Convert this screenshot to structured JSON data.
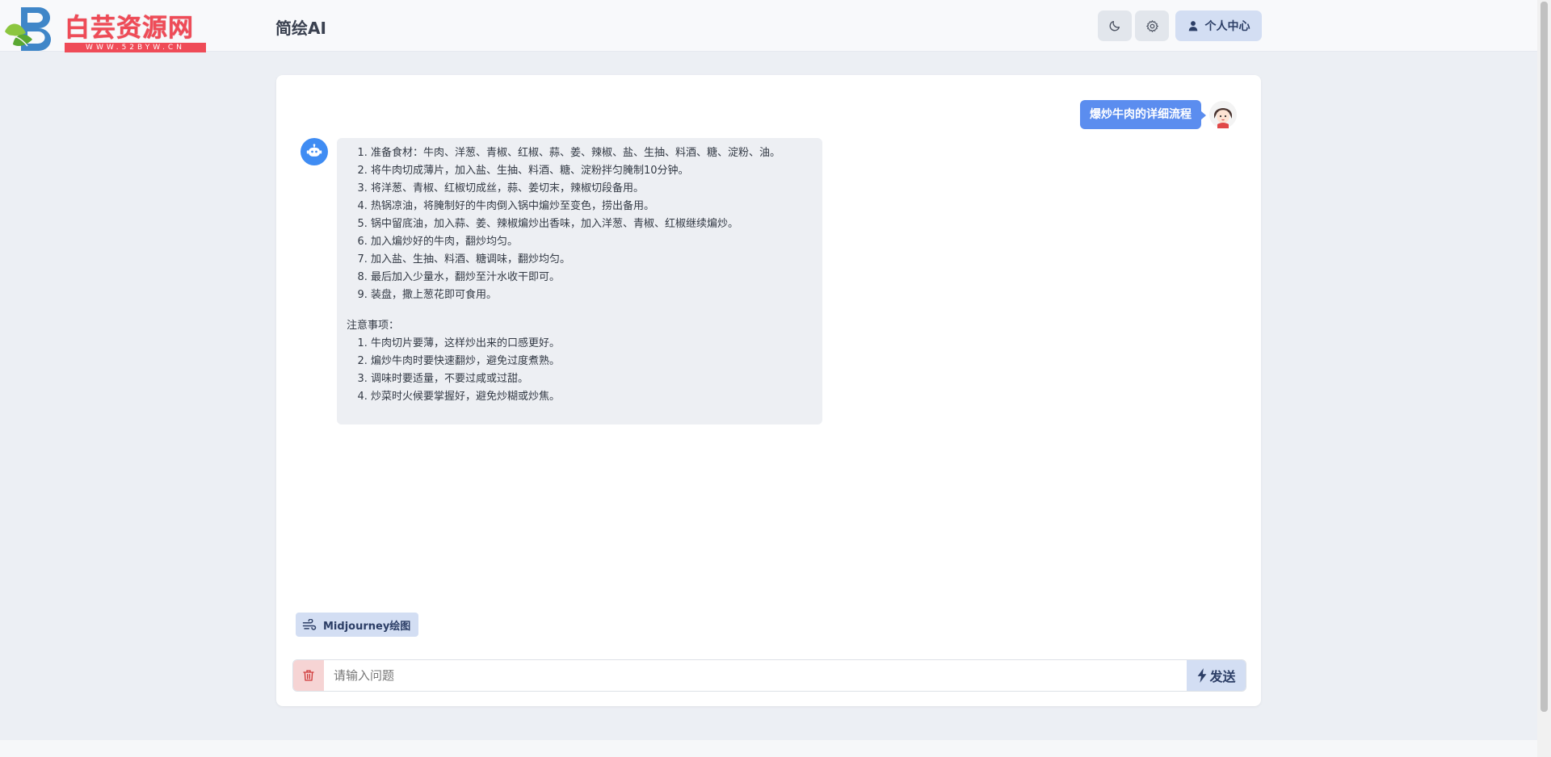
{
  "logo": {
    "text": "白芸资源网",
    "url": "WWW.52BYW.CN"
  },
  "header": {
    "title": "简绘AI",
    "user_center_label": "个人中心"
  },
  "conversation": {
    "user_message": "爆炒牛肉的详细流程",
    "steps": [
      "准备食材：牛肉、洋葱、青椒、红椒、蒜、姜、辣椒、盐、生抽、料酒、糖、淀粉、油。",
      "将牛肉切成薄片，加入盐、生抽、料酒、糖、淀粉拌匀腌制10分钟。",
      "将洋葱、青椒、红椒切成丝，蒜、姜切末，辣椒切段备用。",
      "热锅凉油，将腌制好的牛肉倒入锅中煸炒至变色，捞出备用。",
      "锅中留底油，加入蒜、姜、辣椒煸炒出香味，加入洋葱、青椒、红椒继续煸炒。",
      "加入煸炒好的牛肉，翻炒均匀。",
      "加入盐、生抽、料酒、糖调味，翻炒均匀。",
      "最后加入少量水，翻炒至汁水收干即可。",
      "装盘，撒上葱花即可食用。"
    ],
    "notes_title": "注意事项：",
    "notes": [
      "牛肉切片要薄，这样炒出来的口感更好。",
      "煸炒牛肉时要快速翻炒，避免过度煮熟。",
      "调味时要适量，不要过咸或过甜。",
      "炒菜时火候要掌握好，避免炒糊或炒焦。"
    ]
  },
  "chips": {
    "midjourney_label": "Midjourney绘图"
  },
  "composer": {
    "placeholder": "请输入问题",
    "value": "",
    "send_label": "发送"
  },
  "icons": {
    "dark_mode": "moon-icon",
    "settings": "gear-icon",
    "user": "user-icon",
    "bot": "robot-icon",
    "chip": "wind-icon",
    "trash": "trash-icon",
    "send": "lightning-icon"
  },
  "colors": {
    "accent": "#5b8def",
    "button_bg": "#d3def3",
    "bot_bubble": "#edeff3",
    "danger_bg": "#f6d4d4",
    "logo_red": "#ef4b57"
  }
}
